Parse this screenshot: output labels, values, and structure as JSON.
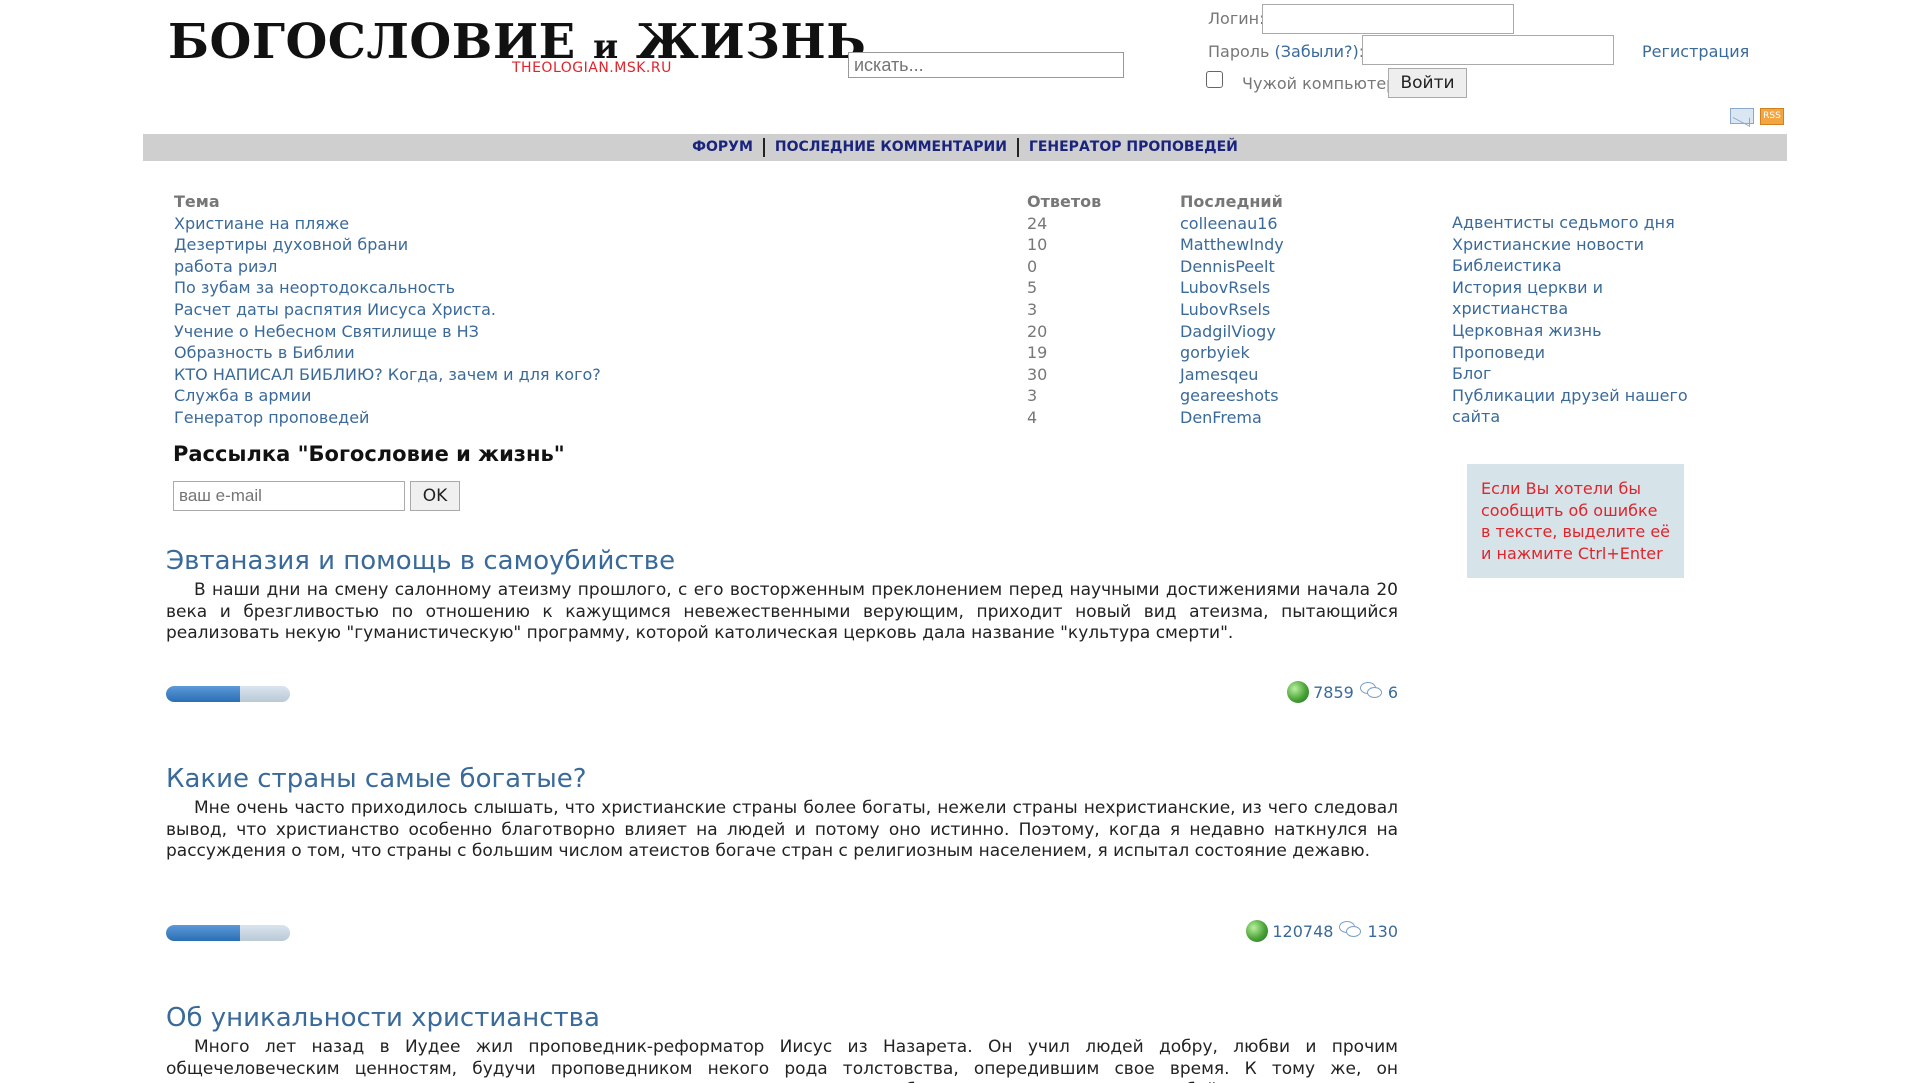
{
  "header": {
    "logo_main": "БОГОСЛОВИЕ",
    "logo_mid": "и",
    "logo_tail": "ЖИЗНЬ",
    "logo_sub": "THEOLOGIAN.MSK.RU",
    "search_placeholder": "искать..."
  },
  "login": {
    "login_label": "Логин:",
    "password_label": "Пароль",
    "forgot_label": "(Забыли?)",
    "password_colon": ":",
    "register_label": "Регистрация",
    "remember_label": "Чужой компьютер",
    "submit_label": "Войти"
  },
  "icons": {
    "mail": "mail-icon",
    "rss": "rss-icon"
  },
  "nav": {
    "forum": "ФОРУМ",
    "latest_comments": "ПОСЛЕДНИЕ КОММЕНТАРИИ",
    "sermon_generator": "ГЕНЕРАТОР ПРОПОВЕДЕЙ"
  },
  "forum": {
    "headers": {
      "topic": "Тема",
      "replies": "Ответов",
      "last": "Последний"
    },
    "rows": [
      {
        "topic": "Христиане на пляже",
        "replies": "24",
        "last": "colleenau16"
      },
      {
        "topic": "Дезертиры духовной брани",
        "replies": "10",
        "last": "MatthewIndy"
      },
      {
        "topic": "работа риэл",
        "replies": "0",
        "last": "DennisPeelt"
      },
      {
        "topic": "По зубам за неортодоксальность",
        "replies": "5",
        "last": "LubovRsels"
      },
      {
        "topic": "Расчет даты распятия Иисуса Христа.",
        "replies": "3",
        "last": "LubovRsels"
      },
      {
        "topic": "Учение о Небесном Святилище в НЗ",
        "replies": "20",
        "last": "DadgilViogy"
      },
      {
        "topic": "Образность в Библии",
        "replies": "19",
        "last": "gorbyiek"
      },
      {
        "topic": "КТО НАПИСАЛ БИБЛИЮ? Когда, зачем и для кого?",
        "replies": "30",
        "last": "Jamesqeu"
      },
      {
        "topic": "Служба в армии",
        "replies": "3",
        "last": "geareeshots"
      },
      {
        "topic": "Генератор проповедей",
        "replies": "4",
        "last": "DenFrema"
      }
    ]
  },
  "categories": [
    "Адвентисты седьмого дня",
    "Христианские новости",
    "Библеистика",
    "История церкви и христианства",
    "Церковная жизнь",
    "Проповеди",
    "Блог",
    "Публикации друзей нашего сайта"
  ],
  "newsletter": {
    "title": "Рассылка \"Богословие и жизнь\"",
    "email_placeholder": "ваш e-mail",
    "ok_label": "OK"
  },
  "error_note": "Если Вы хотели бы сообщить об ошибке в тексте, выделите её и нажмите Ctrl+Enter",
  "articles": [
    {
      "title": "Эвтаназия и помощь в самоубийстве",
      "text": "В наши дни на смену салонному атеизму прошлого, с его восторженным преклонением перед научными достижениями начала 20 века и брезгливостью по отношению к кажущимся невежественными верующим, приходит новый вид атеизма, пытающийся реализовать некую \"гуманистическую\" программу, которой католическая церковь дала название \"культура смерти\".",
      "rating": 0.6,
      "views": "7859",
      "comments": "6"
    },
    {
      "title": "Какие страны самые богатые?",
      "text": "Мне очень  часто приходилось слышать, что христианские страны более богаты, нежели страны нехристианские, из чего следовал вывод, что христианство особенно благотворно влияет на людей и потому оно истинно. Поэтому, когда я недавно наткнулся на рассуждения о том, что страны с большим числом атеистов богаче стран с религиозным населением, я испытал состояние дежавю.",
      "rating": 0.6,
      "views": "120748",
      "comments": "130"
    },
    {
      "title": "Об уникальности христианства",
      "text": "Много лет назад в Иудее жил проповедник-реформатор Иисус из Назарета. Он учил людей добру, любви и прочим общечеловеческим ценностям, будучи проповедником некого рода толстовства, опередившим свое время. К тому же, он симпатизировал угнетенным изгоям и людям из стигматизированных прослоек общества, что наделяло его особой популярностью."
    }
  ]
}
